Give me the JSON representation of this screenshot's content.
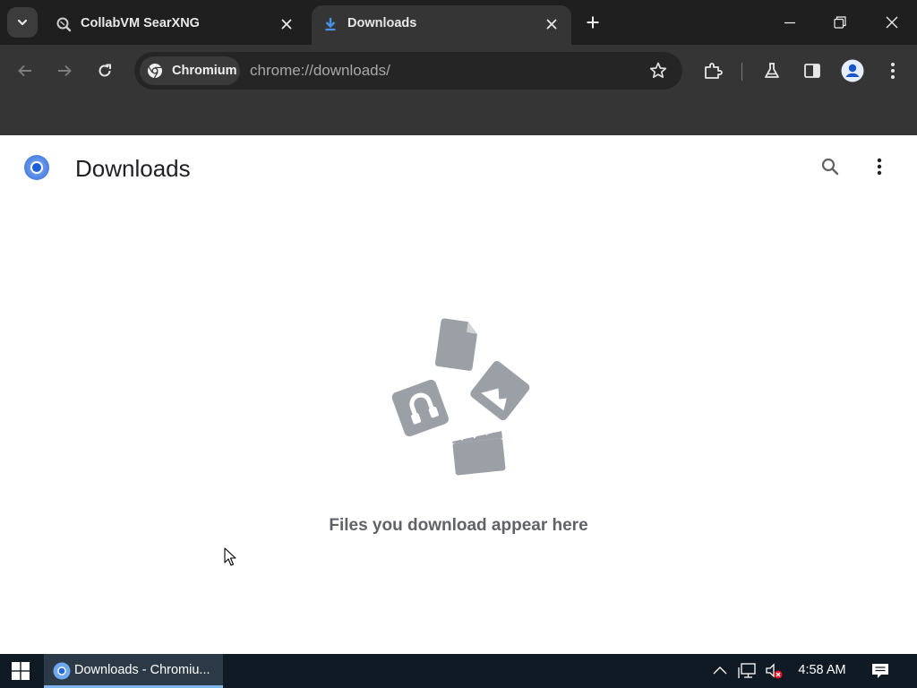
{
  "browser": {
    "tabs": [
      {
        "title": "CollabVM SearXNG",
        "active": false,
        "favicon": "searxng-icon"
      },
      {
        "title": "Downloads",
        "active": true,
        "favicon": "download-icon"
      }
    ],
    "site_chip_label": "Chromium",
    "url": "chrome://downloads/"
  },
  "page": {
    "title": "Downloads",
    "empty_message": "Files you download appear here"
  },
  "taskbar": {
    "window_label": "Downloads - Chromiu...",
    "clock": "4:58 AM"
  },
  "colors": {
    "accent": "#1a73e8",
    "illustration_gray": "#9aa0a6",
    "taskbar_highlight": "#7eb4ea"
  }
}
